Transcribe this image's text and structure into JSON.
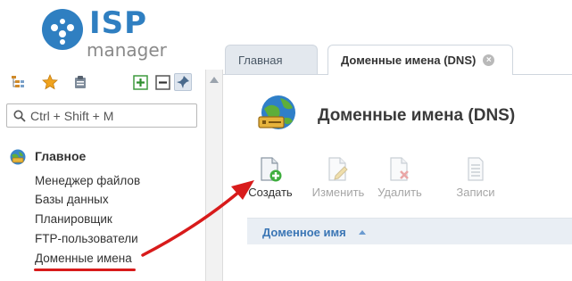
{
  "brand": {
    "name_primary": "ISP",
    "name_secondary": "manager"
  },
  "left_toolbar": {
    "icons": [
      "tree-view-icon",
      "star-icon",
      "clipboard-icon",
      "expand-all-icon",
      "collapse-all-icon",
      "pin-icon"
    ]
  },
  "search": {
    "placeholder": "Ctrl + Shift + M"
  },
  "sidebar": {
    "group_label": "Главное",
    "items": [
      {
        "label": "Менеджер файлов"
      },
      {
        "label": "Базы данных"
      },
      {
        "label": "Планировщик"
      },
      {
        "label": "FTP-пользователи"
      },
      {
        "label": "Доменные имена"
      }
    ],
    "highlighted_item_color": "#d81b1b"
  },
  "tabs": [
    {
      "label": "Главная",
      "active": false
    },
    {
      "label": "Доменные имена (DNS)",
      "active": true
    }
  ],
  "page": {
    "title": "Доменные имена (DNS)"
  },
  "actions": [
    {
      "label": "Создать",
      "enabled": true
    },
    {
      "label": "Изменить",
      "enabled": false
    },
    {
      "label": "Удалить",
      "enabled": false
    },
    {
      "label": "Записи",
      "enabled": false
    }
  ],
  "table": {
    "columns": [
      {
        "label": "Доменное имя",
        "sort": "ascending"
      }
    ]
  },
  "colors": {
    "brand_blue": "#2f7fc1",
    "link_blue": "#3b76b5",
    "annotation_red": "#d81b1b"
  }
}
